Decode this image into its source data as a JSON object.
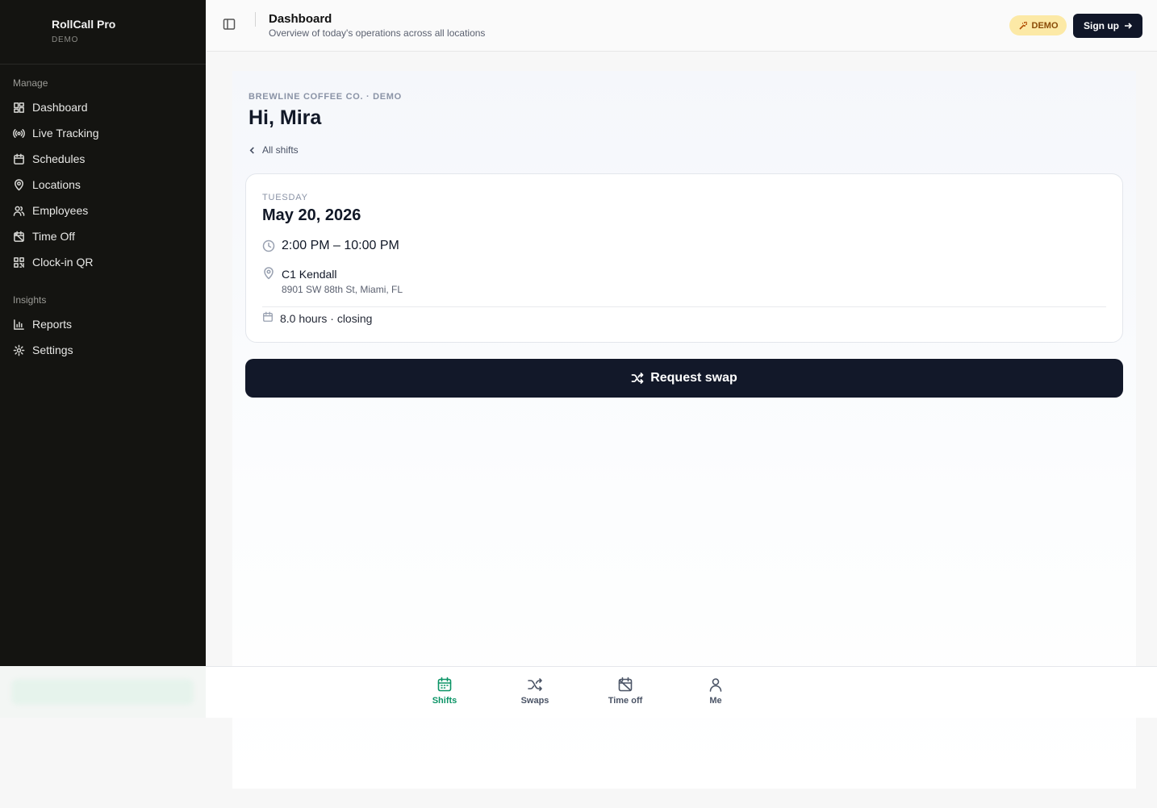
{
  "brand": {
    "title": "RollCall Pro",
    "subtitle": "DEMO"
  },
  "sidebar": {
    "manage_label": "Manage",
    "manage_items": [
      {
        "label": "Dashboard",
        "icon": "dashboard-icon"
      },
      {
        "label": "Live Tracking",
        "icon": "broadcast-icon"
      },
      {
        "label": "Schedules",
        "icon": "calendar-icon"
      },
      {
        "label": "Locations",
        "icon": "map-pin-icon"
      },
      {
        "label": "Employees",
        "icon": "users-icon"
      },
      {
        "label": "Time Off",
        "icon": "calendar-off-icon"
      },
      {
        "label": "Clock-in QR",
        "icon": "qr-code-icon"
      }
    ],
    "insights_label": "Insights",
    "insights_items": [
      {
        "label": "Reports",
        "icon": "bar-chart-icon"
      },
      {
        "label": "Settings",
        "icon": "gear-icon"
      }
    ]
  },
  "header": {
    "title": "Dashboard",
    "subtitle": "Overview of today's operations across all locations",
    "demo_badge": "DEMO",
    "signup_label": "Sign up"
  },
  "main": {
    "company": "BREWLINE COFFEE CO. · DEMO",
    "greeting": "Hi, Mira",
    "back_link": "All shifts",
    "shift": {
      "day": "TUESDAY",
      "date": "May 20, 2026",
      "time": "2:00 PM – 10:00 PM",
      "location_name": "C1 Kendall",
      "location_address": "8901 SW 88th St, Miami, FL",
      "hours": "8.0 hours · closing"
    },
    "swap_label": "Request swap"
  },
  "tabs": [
    {
      "label": "Shifts",
      "icon": "calendar-icon",
      "active": true
    },
    {
      "label": "Swaps",
      "icon": "shuffle-icon",
      "active": false
    },
    {
      "label": "Time off",
      "icon": "calendar-off-icon",
      "active": false
    },
    {
      "label": "Me",
      "icon": "user-icon",
      "active": false
    }
  ],
  "colors": {
    "accent": "#0b9466",
    "sidebar": "#141411",
    "primary_button": "#121829",
    "demo_badge": "#fce9a6"
  }
}
